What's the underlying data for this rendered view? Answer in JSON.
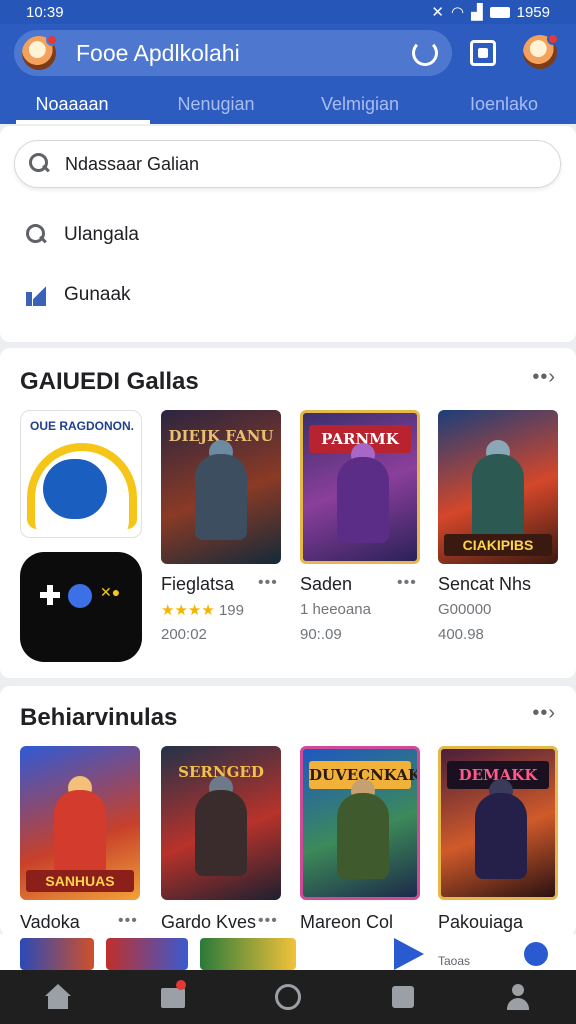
{
  "status": {
    "time": "10:39",
    "right": "1959"
  },
  "header": {
    "title": "Fooe Apdlkolahi"
  },
  "tabs": [
    {
      "label": "Noaaaan"
    },
    {
      "label": "Nenugian"
    },
    {
      "label": "Velmigian"
    },
    {
      "label": "Ioenlako"
    }
  ],
  "search": {
    "value": "Ndassaar Galian",
    "suggestions": [
      {
        "label": "Ulangala",
        "icon": "search-icon"
      },
      {
        "label": "Gunaak",
        "icon": "trending-icon"
      }
    ]
  },
  "section1": {
    "title": "GAIUEDI Gallas",
    "more": "••›",
    "banner": "OUE RAGDONON.",
    "games": [
      {
        "title": "Fieglatsa",
        "rating": "199",
        "sub": "200:02",
        "poster_title": "DIEJK FANU",
        "poster_bottom": ""
      },
      {
        "title": "Saden",
        "rating": "1 heeoana",
        "sub": "90:.09",
        "poster_title": "PARNMK",
        "poster_bottom": ""
      },
      {
        "title": "Sencat Nhs",
        "rating": "G00000",
        "sub": "400.98",
        "poster_title": "",
        "poster_bottom": "CIAKIPIBS"
      }
    ]
  },
  "section2": {
    "title": "Behiarvinulas",
    "more": "••›",
    "games": [
      {
        "title": "Vadoka",
        "poster_title": "",
        "poster_bottom": "SANHUAS"
      },
      {
        "title": "Gardo Kves",
        "poster_title": "SERNGED",
        "poster_bottom": ""
      },
      {
        "title": "Mareon Col",
        "poster_title": "DUVECNKAK",
        "poster_bottom": ""
      },
      {
        "title": "Pakouiaga",
        "poster_title": "DEMAKK",
        "poster_bottom": ""
      }
    ]
  },
  "strip": {
    "label": "Taoas"
  },
  "colors": {
    "primary": "#2d5cc0",
    "accent": "#e53935",
    "nav": "#1f1f1f"
  }
}
